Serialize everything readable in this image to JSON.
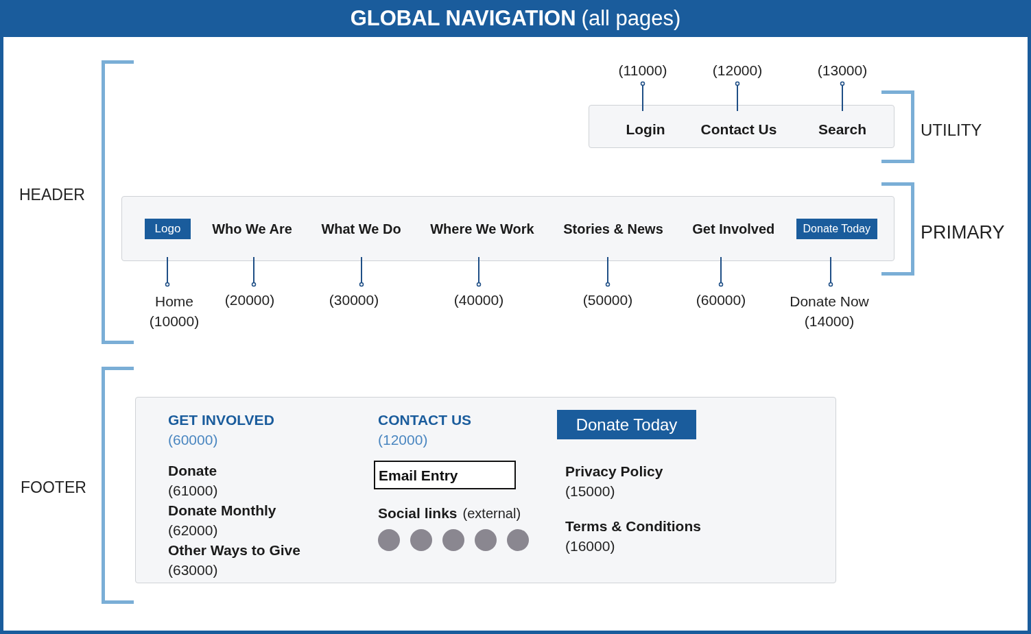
{
  "title": {
    "main": "GLOBAL NAVIGATION",
    "note": "(all pages)"
  },
  "header": {
    "label": "HEADER",
    "utility": {
      "label": "UTILITY",
      "items": [
        {
          "label": "Login",
          "code": "(11000)"
        },
        {
          "label": "Contact Us",
          "code": "(12000)"
        },
        {
          "label": "Search",
          "code": "(13000)"
        }
      ]
    },
    "primary": {
      "label": "PRIMARY",
      "logo": {
        "label": "Logo",
        "caption": "Home",
        "code": "(10000)"
      },
      "items": [
        {
          "label": "Who We Are",
          "code": "(20000)"
        },
        {
          "label": "What We Do",
          "code": "(30000)"
        },
        {
          "label": "Where We Work",
          "code": "(40000)"
        },
        {
          "label": "Stories & News",
          "code": "(50000)"
        },
        {
          "label": "Get Involved",
          "code": "(60000)"
        }
      ],
      "donate": {
        "label": "Donate Today",
        "caption": "Donate Now",
        "code": "(14000)"
      }
    }
  },
  "footer": {
    "label": "FOOTER",
    "get_involved": {
      "heading": "GET INVOLVED",
      "code": "(60000)",
      "links": [
        {
          "label": "Donate",
          "code": "(61000)"
        },
        {
          "label": "Donate Monthly",
          "code": "(62000)"
        },
        {
          "label": "Other Ways to Give",
          "code": "(63000)"
        }
      ]
    },
    "contact": {
      "heading": "CONTACT US",
      "code": "(12000)",
      "email_value": "Email Entry",
      "social_label": "Social links",
      "social_note": "(external)"
    },
    "donate_button": "Donate Today",
    "legal": [
      {
        "label": "Privacy Policy",
        "code": "(15000)"
      },
      {
        "label": "Terms & Conditions",
        "code": "(16000)"
      }
    ]
  }
}
